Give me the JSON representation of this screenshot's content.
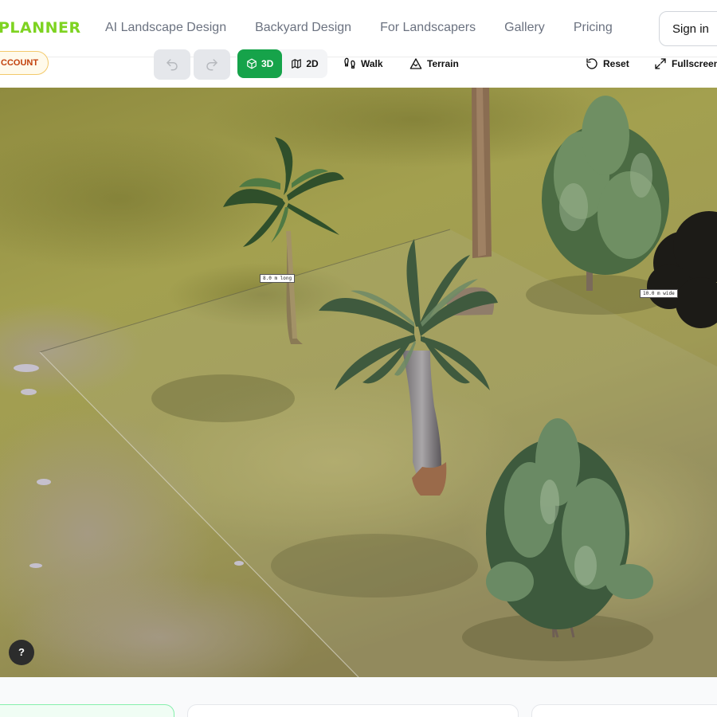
{
  "brand": {
    "name": "PLANNER"
  },
  "nav": {
    "links": [
      "AI Landscape Design",
      "Backyard Design",
      "For Landscapers",
      "Gallery",
      "Pricing"
    ],
    "signin": "Sign in"
  },
  "toolbar": {
    "account": "CCOUNT",
    "view_3d": "3D",
    "view_2d": "2D",
    "walk": "Walk",
    "terrain": "Terrain",
    "reset": "Reset",
    "fullscreen": "Fullscreen",
    "active_view": "3D"
  },
  "scene": {
    "label_length": "8.0 m long",
    "label_width": "10.0 m wide",
    "help": "?"
  },
  "colors": {
    "brand": "#7ed321",
    "active": "#16a34a",
    "account_text": "#c2410c"
  },
  "icons": [
    "undo-icon",
    "redo-icon",
    "cube-icon",
    "map-icon",
    "footprints-icon",
    "mountain-icon",
    "reset-icon",
    "expand-icon"
  ]
}
